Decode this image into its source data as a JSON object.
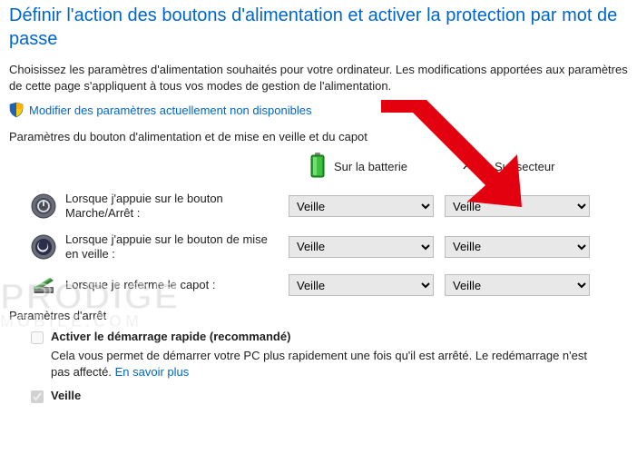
{
  "title": "Définir l'action des boutons d'alimentation et activer la protection par mot de passe",
  "intro": "Choisissez les paramètres d'alimentation souhaités pour votre ordinateur. Les modifications apportées aux paramètres de cette page s'appliquent à tous vos modes de gestion de l'alimentation.",
  "adminLink": "Modifier des paramètres actuellement non disponibles",
  "sectionButtons": "Paramètres du bouton d'alimentation et de mise en veille et du capot",
  "colBattery": "Sur la batterie",
  "colPlugged": "Sur secteur",
  "rows": [
    {
      "label": "Lorsque j'appuie sur le bouton Marche/Arrêt :",
      "battery": "Veille",
      "plugged": "Veille"
    },
    {
      "label": "Lorsque j'appuie sur le bouton de mise en veille :",
      "battery": "Veille",
      "plugged": "Veille"
    },
    {
      "label": "Lorsque je referme le capot :",
      "battery": "Veille",
      "plugged": "Veille"
    }
  ],
  "sectionShutdown": "Paramètres d'arrêt",
  "fastStartup": {
    "label": "Activer le démarrage rapide (recommandé)",
    "desc": "Cela vous permet de démarrer votre PC plus rapidement une fois qu'il est arrêté. Le redémarrage n'est pas affecté. ",
    "learnMore": "En savoir plus"
  },
  "sleep": {
    "label": "Veille"
  },
  "watermark": {
    "main": "PRODIGE",
    "sub": "MOBILE.COM"
  }
}
